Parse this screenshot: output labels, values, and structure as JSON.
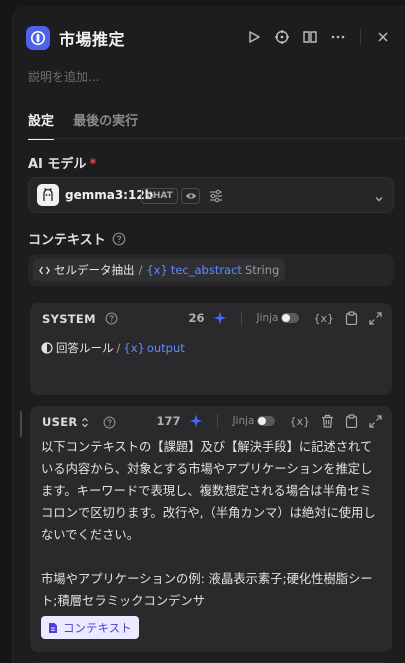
{
  "header": {
    "title": "市場推定",
    "description_placeholder": "説明を追加..."
  },
  "tabs": [
    {
      "label": "設定",
      "active": true
    },
    {
      "label": "最後の実行",
      "active": false
    }
  ],
  "model": {
    "label": "AI モデル",
    "required_mark": "*",
    "name": "gemma3:12b",
    "mode_chip": "CHAT"
  },
  "context": {
    "label": "コンテキスト",
    "source_node": "セルデータ抽出",
    "separator": "/",
    "var_prefix": "{x}",
    "var_name": "tec_abstract",
    "var_type": "String"
  },
  "system_card": {
    "role": "SYSTEM",
    "tokens": "26",
    "jinja_label": "Jinja",
    "var_prefix": "{x}",
    "ref_node": "回答ルール",
    "ref_separator": "/",
    "ref_var_prefix": "{x}",
    "ref_var": "output"
  },
  "user_card": {
    "role": "USER",
    "tokens": "177",
    "jinja_label": "Jinja",
    "var_prefix": "{x}",
    "text_line1": "以下コンテキストの【課題】及び【解決手段】に記述されている内容から、対象とする市場やアプリケーションを推定します。キーワードで表現し、複数想定される場合は半角セミコロンで区切ります。改行や,（半角カンマ）は絶対に使用しないでください。",
    "text_line2": "市場やアプリケーションの例: 液晶表示素子;硬化性樹脂シート;積層セラミックコンデンサ",
    "context_button": "コンテキスト"
  },
  "colors": {
    "accent": "#4f63e8",
    "variable": "#5b8cff",
    "sparkle": "#3f6bff",
    "context_button_bg": "#eceaff",
    "context_button_fg": "#4d3fd8",
    "required": "#e5484d"
  },
  "icons": [
    "node-icon",
    "play-icon",
    "crosshair-icon",
    "split-view-icon",
    "more-icon",
    "close-icon",
    "help-icon",
    "sparkle-icon",
    "variable-icon",
    "clipboard-icon",
    "expand-icon",
    "trash-icon",
    "eye-icon",
    "sliders-icon",
    "chevron-down-icon",
    "document-icon"
  ]
}
